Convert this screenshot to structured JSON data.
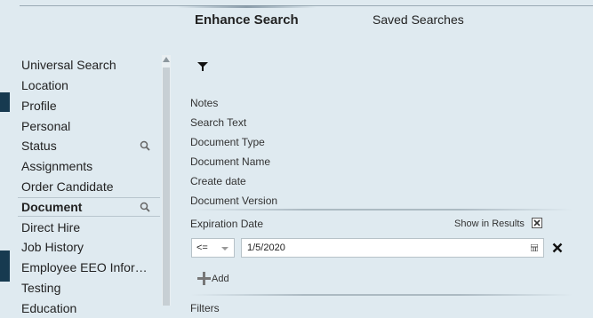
{
  "tabs": {
    "enhance": "Enhance Search",
    "saved": "Saved Searches"
  },
  "sidebar": {
    "items": [
      {
        "label": "Universal Search"
      },
      {
        "label": "Location"
      },
      {
        "label": "Profile"
      },
      {
        "label": "Personal"
      },
      {
        "label": "Status"
      },
      {
        "label": "Assignments"
      },
      {
        "label": "Order Candidate"
      },
      {
        "label": "Document"
      },
      {
        "label": "Direct Hire"
      },
      {
        "label": "Job History"
      },
      {
        "label": "Employee EEO Infor…"
      },
      {
        "label": "Testing"
      },
      {
        "label": "Education"
      }
    ],
    "active": "Document"
  },
  "fields": [
    "Notes",
    "Search Text",
    "Document Type",
    "Document Name",
    "Create date",
    "Document Version"
  ],
  "expiration": {
    "label": "Expiration Date",
    "show_in_results": "Show in Results",
    "operator": "<=",
    "value": "1/5/2020"
  },
  "add_label": "Add",
  "next_section": "Filters",
  "colors": {
    "accent": "#173a50",
    "background": "#dfeaf0"
  }
}
